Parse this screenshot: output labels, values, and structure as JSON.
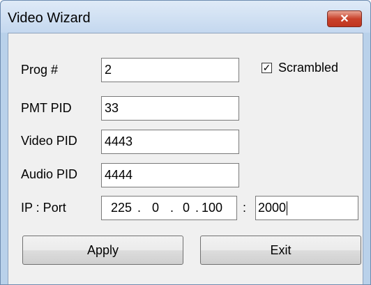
{
  "window": {
    "title": "Video Wizard",
    "close_glyph": "✕"
  },
  "form": {
    "prog_label": "Prog #",
    "prog_value": "2",
    "scrambled_label": "Scrambled",
    "scrambled_checked": true,
    "scrambled_mark": "✓",
    "pmt_label": "PMT PID",
    "pmt_value": "33",
    "video_label": "Video PID",
    "video_value": "4443",
    "audio_label": "Audio PID",
    "audio_value": "4444",
    "ip_label": "IP : Port",
    "ip_octets": [
      "225",
      "0",
      "0",
      "100"
    ],
    "ip_dot": ".",
    "port_separator": ":",
    "port_value": "2000"
  },
  "buttons": {
    "apply_label": "Apply",
    "exit_label": "Exit"
  },
  "colors": {
    "titlebar": "#c4d8ef",
    "close_button": "#c9422b",
    "client": "#f0f0f0"
  }
}
